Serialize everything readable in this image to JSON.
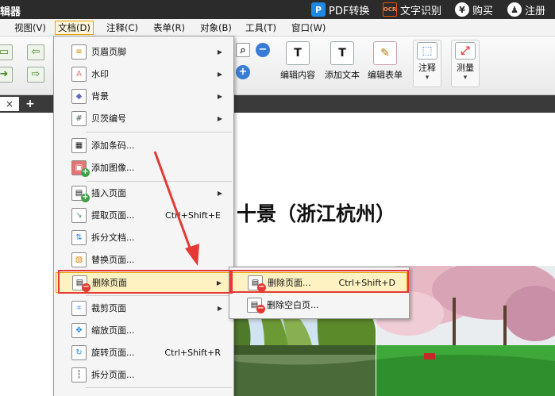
{
  "titlebar": {
    "app_title": "辑器",
    "actions": [
      {
        "label": "PDF转换",
        "icon": "pdf-convert-icon"
      },
      {
        "label": "文字识别",
        "icon": "ocr-icon"
      },
      {
        "label": "购买",
        "icon": "yen-icon"
      },
      {
        "label": "注册",
        "icon": "user-icon"
      }
    ],
    "icon_glyphs": {
      "pdf": "P",
      "ocr": "OCR",
      "yen": "¥",
      "user": "♟"
    }
  },
  "menubar": {
    "items": [
      "视图(V)",
      "文档(D)",
      "注释(C)",
      "表单(R)",
      "对象(B)",
      "工具(T)",
      "窗口(W)"
    ],
    "active": "文档(D)"
  },
  "toolbar": {
    "buttons": [
      {
        "label": "编辑内容",
        "glyph": "T"
      },
      {
        "label": "添加文本",
        "glyph": "T"
      },
      {
        "label": "编辑表单",
        "glyph": "✎"
      },
      {
        "label": "注释",
        "glyph": "⬚"
      },
      {
        "label": "测量",
        "glyph": "⤢"
      }
    ],
    "dropdown_caret": "▾",
    "zoom_out_glyph": "−",
    "zoom_in_glyph": "+"
  },
  "tabs": {
    "close_glyph": "×",
    "add_glyph": "+"
  },
  "document": {
    "title": "十景（浙江杭州）"
  },
  "document_menu": {
    "items": [
      {
        "label": "页眉页脚",
        "shortcut": "",
        "submenu": true,
        "glyph": "≡"
      },
      {
        "label": "水印",
        "shortcut": "",
        "submenu": true,
        "glyph": "A"
      },
      {
        "label": "背景",
        "shortcut": "",
        "submenu": true,
        "glyph": "◆"
      },
      {
        "label": "贝茨编号",
        "shortcut": "",
        "submenu": true,
        "glyph": "#"
      },
      {
        "label": "添加条码...",
        "shortcut": "",
        "submenu": false,
        "glyph": "▦"
      },
      {
        "label": "添加图像...",
        "shortcut": "",
        "submenu": false,
        "glyph": "▣"
      },
      {
        "label": "插入页面",
        "shortcut": "",
        "submenu": true,
        "glyph": "▤"
      },
      {
        "label": "提取页面...",
        "shortcut": "Ctrl+Shift+E",
        "submenu": false,
        "glyph": "↘"
      },
      {
        "label": "拆分文档...",
        "shortcut": "",
        "submenu": false,
        "glyph": "⇅"
      },
      {
        "label": "替换页面...",
        "shortcut": "",
        "submenu": false,
        "glyph": "▧"
      },
      {
        "label": "删除页面",
        "shortcut": "",
        "submenu": true,
        "glyph": "▤"
      },
      {
        "label": "裁剪页面",
        "shortcut": "",
        "submenu": true,
        "glyph": "⌗"
      },
      {
        "label": "缩放页面...",
        "shortcut": "",
        "submenu": false,
        "glyph": "✥"
      },
      {
        "label": "旋转页面...",
        "shortcut": "Ctrl+Shift+R",
        "submenu": false,
        "glyph": "↻"
      },
      {
        "label": "拆分页面...",
        "shortcut": "",
        "submenu": false,
        "glyph": "┆"
      }
    ],
    "submenu_arrow": "▶"
  },
  "delete_submenu": {
    "items": [
      {
        "label": "删除页面...",
        "shortcut": "Ctrl+Shift+D"
      },
      {
        "label": "删除空白页..."
      }
    ],
    "glyph": "▤"
  },
  "badges": {
    "add": "+",
    "remove": "−"
  },
  "colors": {
    "highlight_border": "#e9a200",
    "highlight_fill": "#fff2c2",
    "annotation_red": "#e53935",
    "titlebar_bg": "#2b2b2b"
  }
}
